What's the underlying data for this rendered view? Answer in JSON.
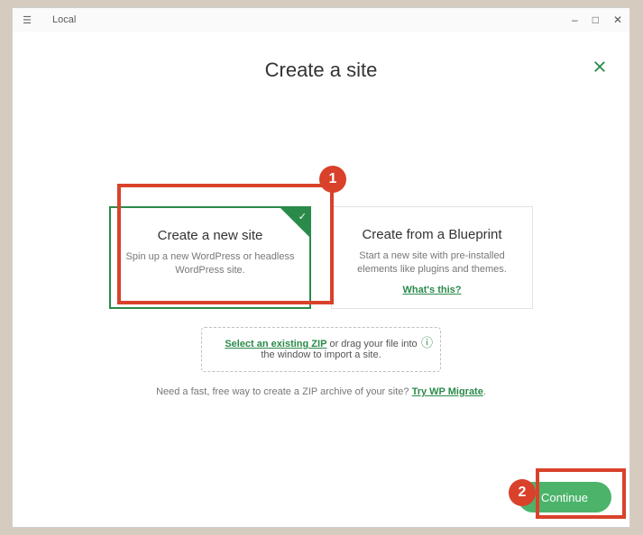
{
  "window": {
    "app_name": "Local"
  },
  "page": {
    "title": "Create a site"
  },
  "options": {
    "new_site": {
      "title": "Create a new site",
      "desc": "Spin up a new WordPress or headless WordPress site."
    },
    "blueprint": {
      "title": "Create from a Blueprint",
      "desc": "Start a new site with pre-installed elements like plugins and themes.",
      "whats_this": "What's this?"
    }
  },
  "zip": {
    "link_text": "Select an existing ZIP",
    "rest": " or drag your file into the window to import a site."
  },
  "hint": {
    "text": "Need a fast, free way to create a ZIP archive of your site? ",
    "link": "Try WP Migrate",
    "trailing": "."
  },
  "footer": {
    "continue": "Continue"
  },
  "annotations": {
    "1": "1",
    "2": "2"
  }
}
